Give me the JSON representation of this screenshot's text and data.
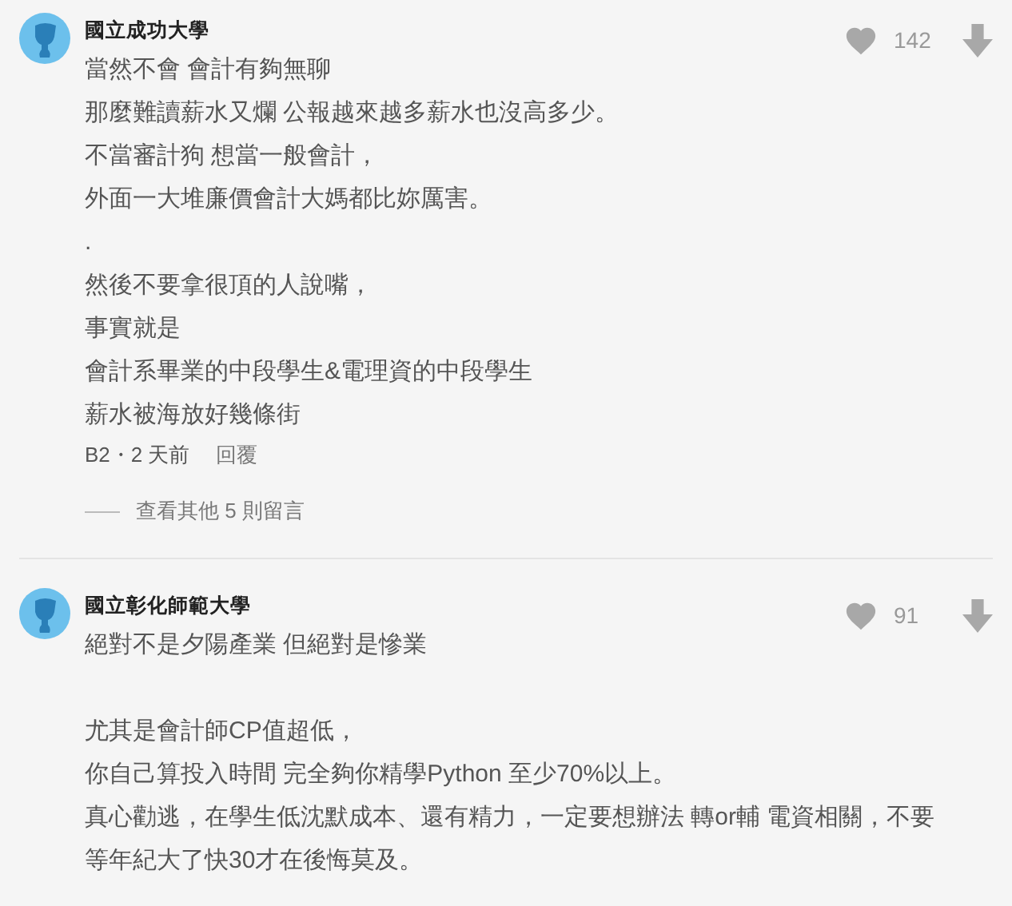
{
  "comments": [
    {
      "author": "國立成功大學",
      "likes": "142",
      "paragraphs": [
        [
          "當然不會 會計有夠無聊",
          "那麼難讀薪水又爛 公報越來越多薪水也沒高多少。",
          "不當審計狗 想當一般會計，",
          "外面一大堆廉價會計大媽都比妳厲害。"
        ],
        [
          ".",
          "然後不要拿很頂的人說嘴，",
          "事實就是",
          "會計系畢業的中段學生&電理資的中段學生",
          "薪水被海放好幾條街"
        ]
      ],
      "floor": "B2・2 天前",
      "reply": "回覆",
      "more": "查看其他 5 則留言"
    },
    {
      "author": "國立彰化師範大學",
      "likes": "91",
      "paragraphs": [
        [
          "絕對不是夕陽產業 但絕對是慘業"
        ],
        [
          "尤其是會計師CP值超低，",
          "你自己算投入時間 完全夠你精學Python 至少70%以上。",
          "真心勸逃，在學生低沈默成本、還有精力，一定要想辦法 轉or輔 電資相關，不要",
          "等年紀大了快30才在後悔莫及。"
        ]
      ]
    }
  ]
}
